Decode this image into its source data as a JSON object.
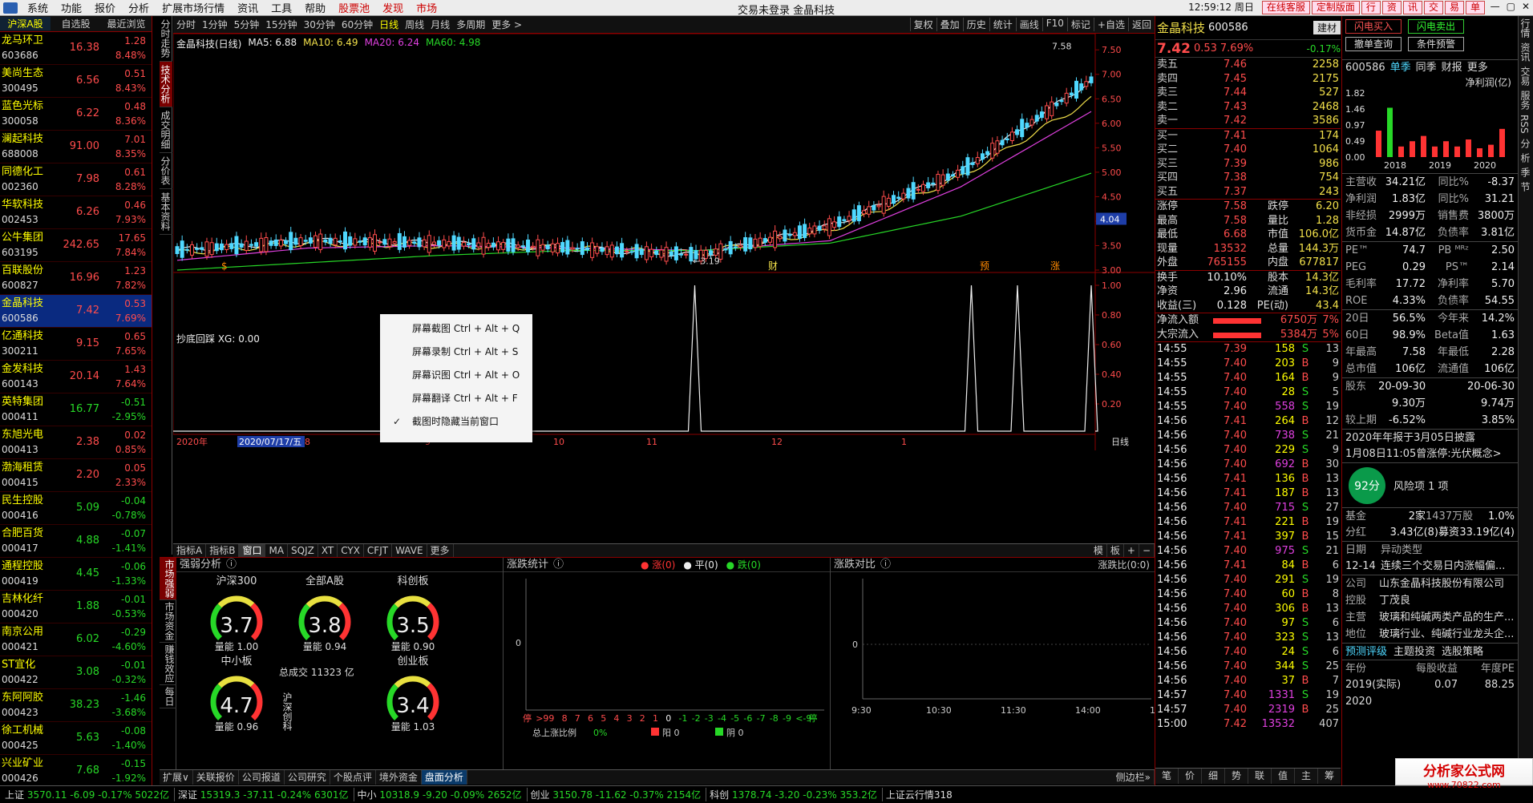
{
  "menubar": {
    "items": [
      {
        "label": "系统",
        "hot": false
      },
      {
        "label": "功能",
        "hot": false
      },
      {
        "label": "报价",
        "hot": false
      },
      {
        "label": "分析",
        "hot": false
      },
      {
        "label": "扩展市场行情",
        "hot": false
      },
      {
        "label": "资讯",
        "hot": false
      },
      {
        "label": "工具",
        "hot": false
      },
      {
        "label": "帮助",
        "hot": false
      },
      {
        "label": "股票池",
        "hot": true
      },
      {
        "label": "发现",
        "hot": true
      },
      {
        "label": "市场",
        "hot": true
      }
    ],
    "title": "交易未登录  金晶科技",
    "clock": "12:59:12 周日",
    "right_buttons": [
      "在线客服",
      "定制版面",
      "行",
      "资",
      "讯",
      "交",
      "易",
      "单"
    ],
    "window_controls": [
      "—",
      "▢",
      "✕"
    ]
  },
  "left": {
    "tabs": [
      "沪深A股",
      "自选股",
      "最近浏览"
    ],
    "stocks": [
      {
        "name": "龙马环卫",
        "code": "603686",
        "price": "16.38",
        "chg": "1.28",
        "pct": "8.48%",
        "dir": "up"
      },
      {
        "name": "美尚生态",
        "code": "300495",
        "price": "6.56",
        "chg": "0.51",
        "pct": "8.43%",
        "dir": "up"
      },
      {
        "name": "蓝色光标",
        "code": "300058",
        "price": "6.22",
        "chg": "0.48",
        "pct": "8.36%",
        "dir": "up"
      },
      {
        "name": "澜起科技",
        "code": "688008",
        "price": "91.00",
        "chg": "7.01",
        "pct": "8.35%",
        "dir": "up"
      },
      {
        "name": "同德化工",
        "code": "002360",
        "price": "7.98",
        "chg": "0.61",
        "pct": "8.28%",
        "dir": "up"
      },
      {
        "name": "华软科技",
        "code": "002453",
        "price": "6.26",
        "chg": "0.46",
        "pct": "7.93%",
        "dir": "up"
      },
      {
        "name": "公牛集团",
        "code": "603195",
        "price": "242.65",
        "chg": "17.65",
        "pct": "7.84%",
        "dir": "up"
      },
      {
        "name": "百联股份",
        "code": "600827",
        "price": "16.96",
        "chg": "1.23",
        "pct": "7.82%",
        "dir": "up"
      },
      {
        "name": "金晶科技",
        "code": "600586",
        "price": "7.42",
        "chg": "0.53",
        "pct": "7.69%",
        "dir": "up",
        "selected": true
      },
      {
        "name": "亿通科技",
        "code": "300211",
        "price": "9.15",
        "chg": "0.65",
        "pct": "7.65%",
        "dir": "up"
      },
      {
        "name": "金发科技",
        "code": "600143",
        "price": "20.14",
        "chg": "1.43",
        "pct": "7.64%",
        "dir": "up"
      },
      {
        "name": "英特集团",
        "code": "000411",
        "price": "16.77",
        "chg": "-0.51",
        "pct": "-2.95%",
        "dir": "dn"
      },
      {
        "name": "东旭光电",
        "code": "000413",
        "price": "2.38",
        "chg": "0.02",
        "pct": "0.85%",
        "dir": "up"
      },
      {
        "name": "渤海租赁",
        "code": "000415",
        "price": "2.20",
        "chg": "0.05",
        "pct": "2.33%",
        "dir": "up"
      },
      {
        "name": "民生控股",
        "code": "000416",
        "price": "5.09",
        "chg": "-0.04",
        "pct": "-0.78%",
        "dir": "dn"
      },
      {
        "name": "合肥百货",
        "code": "000417",
        "price": "4.88",
        "chg": "-0.07",
        "pct": "-1.41%",
        "dir": "dn"
      },
      {
        "name": "通程控股",
        "code": "000419",
        "price": "4.45",
        "chg": "-0.06",
        "pct": "-1.33%",
        "dir": "dn"
      },
      {
        "name": "吉林化纤",
        "code": "000420",
        "price": "1.88",
        "chg": "-0.01",
        "pct": "-0.53%",
        "dir": "dn"
      },
      {
        "name": "南京公用",
        "code": "000421",
        "price": "6.02",
        "chg": "-0.29",
        "pct": "-4.60%",
        "dir": "dn"
      },
      {
        "name": "ST宜化",
        "code": "000422",
        "price": "3.08",
        "chg": "-0.01",
        "pct": "-0.32%",
        "dir": "dn"
      },
      {
        "name": "东阿阿胶",
        "code": "000423",
        "price": "38.23",
        "chg": "-1.46",
        "pct": "-3.68%",
        "dir": "dn"
      },
      {
        "name": "徐工机械",
        "code": "000425",
        "price": "5.63",
        "chg": "-0.08",
        "pct": "-1.40%",
        "dir": "dn"
      },
      {
        "name": "兴业矿业",
        "code": "000426",
        "price": "7.68",
        "chg": "-0.15",
        "pct": "-1.92%",
        "dir": "dn"
      }
    ]
  },
  "side_tabs": [
    "分时走势",
    "技术分析",
    "成交明细",
    "分价表",
    "基本资料"
  ],
  "ktool": {
    "periods": [
      "分时",
      "1分钟",
      "5分钟",
      "15分钟",
      "30分钟",
      "60分钟",
      "日线",
      "周线",
      "月线",
      "多周期",
      "更多 >"
    ],
    "active": "日线",
    "right": [
      "复权",
      "叠加",
      "历史",
      "统计",
      "画线",
      "F10",
      "标记",
      "+自选",
      "返回"
    ]
  },
  "chart": {
    "title": "金晶科技(日线)",
    "ma_legend": [
      {
        "label": "MA5: 6.88",
        "color": "#eeeeee"
      },
      {
        "label": "MA10: 6.49",
        "color": "#f2e04a"
      },
      {
        "label": "MA20: 6.24",
        "color": "#e040e0"
      },
      {
        "label": "MA60: 4.98",
        "color": "#27d827"
      }
    ],
    "price_ticks": [
      "7.50",
      "7.00",
      "6.50",
      "6.00",
      "5.50",
      "5.00",
      "4.50",
      "4.00",
      "3.50",
      "3.00"
    ],
    "high_label": "7.58",
    "low_label": "3.19",
    "cursor_price": "4.04",
    "markers": [
      "$",
      "财",
      "预",
      "涨"
    ],
    "indicator_title": "抄底回踩  XG: 0.00",
    "indicator_ticks": [
      "1.00",
      "0.80",
      "0.60",
      "0.40",
      "0.20"
    ],
    "date_labels": [
      "2020年",
      "2020/07/17/五",
      "8",
      "9",
      "10",
      "11",
      "12",
      "1"
    ],
    "period_label": "日线"
  },
  "chart_data": {
    "type": "line",
    "title": "金晶科技(日线)",
    "xlabel": "",
    "ylabel": "",
    "ylim": [
      3.0,
      7.7
    ],
    "x": [
      "2020-06",
      "2020-07",
      "2020-08",
      "2020-09",
      "2020-10",
      "2020-11",
      "2020-12",
      "2021-01"
    ],
    "series": [
      {
        "name": "MA5",
        "values": [
          3.4,
          3.6,
          3.55,
          3.45,
          3.3,
          3.9,
          5.0,
          6.88
        ]
      },
      {
        "name": "MA10",
        "values": [
          3.35,
          3.55,
          3.5,
          3.45,
          3.35,
          3.8,
          4.9,
          6.49
        ]
      },
      {
        "name": "MA20",
        "values": [
          3.2,
          3.45,
          3.5,
          3.45,
          3.4,
          3.6,
          4.7,
          6.24
        ]
      },
      {
        "name": "MA60",
        "values": [
          3.0,
          3.15,
          3.3,
          3.4,
          3.4,
          3.55,
          4.1,
          4.98
        ]
      }
    ],
    "indicator": {
      "name": "XG",
      "signal_positions": [
        0.47,
        0.77,
        0.82,
        0.9
      ],
      "value": 0.0
    }
  },
  "context_menu": [
    {
      "label": "屏幕截图 Ctrl + Alt + Q",
      "checked": false
    },
    {
      "label": "屏幕录制 Ctrl + Alt + S",
      "checked": false
    },
    {
      "label": "屏幕识图 Ctrl + Alt + O",
      "checked": false
    },
    {
      "label": "屏幕翻译 Ctrl + Alt + F",
      "checked": false
    },
    {
      "label": "截图时隐藏当前窗口",
      "checked": true
    }
  ],
  "index_tabs": [
    "指标A",
    "指标B",
    "窗口",
    "MA",
    "SQJZ",
    "XT",
    "CYX",
    "CFJT",
    "WAVE",
    "更多"
  ],
  "index_tabs_right": [
    "模",
    "板",
    "+",
    "−"
  ],
  "bottom": {
    "vtabs": [
      "市场强弱",
      "市场资金",
      "赚钱效应",
      "每日"
    ],
    "strength": {
      "title": "强弱分析",
      "gauges": [
        {
          "name": "沪深300",
          "value": "3.7",
          "q": "量能 1.00"
        },
        {
          "name": "全部A股",
          "value": "3.8",
          "q": "量能 0.94"
        },
        {
          "name": "科创板",
          "value": "3.5",
          "q": "量能 0.90"
        },
        {
          "name": "中小板",
          "value": "4.7",
          "q": "量能 0.96"
        },
        {
          "name": "创业板",
          "value": "3.4",
          "q": "量能 1.03"
        }
      ],
      "total": "总成交 11323 亿",
      "vertical_label": "沪深创科"
    },
    "rise_fall": {
      "title": "涨跌统计",
      "legend": [
        "涨(0)",
        "平(0)",
        "跌(0)"
      ],
      "zero": "0",
      "xaxis": [
        "停",
        ">9",
        "9",
        "8",
        "7",
        "6",
        "5",
        "4",
        "3",
        "2",
        "1",
        "0",
        "-1",
        "-2",
        "-3",
        "-4",
        "-5",
        "-6",
        "-7",
        "-8",
        "-9",
        "<-9",
        "停"
      ],
      "footer": {
        "ratio_label": "总上涨比例",
        "ratio": "0%",
        "yang": "阳 0",
        "yin": "阴 0"
      }
    },
    "compare": {
      "title": "涨跌对比",
      "ratio": "涨跌比(0:0)",
      "zero": "0",
      "times": [
        "9:30",
        "10:30",
        "11:30",
        "14:00",
        "15:00"
      ]
    }
  },
  "btabs": [
    "扩展∨",
    "关联报价",
    "公司报道",
    "公司研究",
    "个股点评",
    "境外资金",
    "盘面分析"
  ],
  "btabs_active": "盘面分析",
  "btabs_right": "侧边栏»",
  "status": [
    {
      "label": "上证",
      "vals": "3570.11  -6.09  -0.17%  5022亿"
    },
    {
      "label": "深证",
      "vals": "15319.3  -37.11  -0.24%  6301亿"
    },
    {
      "label": "中小",
      "vals": "10318.9  -9.20  -0.09%  2652亿"
    },
    {
      "label": "创业",
      "vals": "3150.78  -11.62  -0.37%  2154亿"
    },
    {
      "label": "科创",
      "vals": "1378.74  -3.20  -0.23%  353.2亿"
    },
    {
      "label": "",
      "vals": "上证云行情318"
    }
  ],
  "quote": {
    "name": "金晶科技",
    "code": "600586",
    "sector": "建材",
    "sector_pct": "-0.17%",
    "price": "7.42",
    "chg": "0.53",
    "pct": "7.69%",
    "asks": [
      {
        "l": "卖五",
        "p": "7.46",
        "v": "2258"
      },
      {
        "l": "卖四",
        "p": "7.45",
        "v": "2175"
      },
      {
        "l": "卖三",
        "p": "7.44",
        "v": "527"
      },
      {
        "l": "卖二",
        "p": "7.43",
        "v": "2468"
      },
      {
        "l": "卖一",
        "p": "7.42",
        "v": "3586"
      }
    ],
    "bids": [
      {
        "l": "买一",
        "p": "7.41",
        "v": "174"
      },
      {
        "l": "买二",
        "p": "7.40",
        "v": "1064"
      },
      {
        "l": "买三",
        "p": "7.39",
        "v": "986"
      },
      {
        "l": "买四",
        "p": "7.38",
        "v": "754"
      },
      {
        "l": "买五",
        "p": "7.37",
        "v": "243"
      }
    ],
    "stats": [
      [
        "涨停",
        "7.58",
        "跌停",
        "6.20"
      ],
      [
        "最高",
        "7.58",
        "量比",
        "1.28"
      ],
      [
        "最低",
        "6.68",
        "市值",
        "106.0亿"
      ],
      [
        "现量",
        "13532",
        "总量",
        "144.3万"
      ],
      [
        "外盘",
        "765155",
        "内盘",
        "677817"
      ]
    ],
    "stats2": [
      [
        "换手",
        "10.10%",
        "股本",
        "14.3亿"
      ],
      [
        "净资",
        "2.96",
        "流通",
        "14.3亿"
      ],
      [
        "收益(三)",
        "0.128",
        "PE(动)",
        "43.4"
      ]
    ],
    "flows": [
      {
        "l": "净流入额",
        "v": "6750万",
        "p": "7%"
      },
      {
        "l": "大宗流入",
        "v": "5384万",
        "p": "5%"
      }
    ],
    "ticks": [
      {
        "t": "14:55",
        "p": "7.39",
        "v": "158",
        "d": "S",
        "n": "13"
      },
      {
        "t": "14:55",
        "p": "7.40",
        "v": "203",
        "d": "B",
        "n": "9"
      },
      {
        "t": "14:55",
        "p": "7.40",
        "v": "164",
        "d": "B",
        "n": "9"
      },
      {
        "t": "14:55",
        "p": "7.40",
        "v": "28",
        "d": "S",
        "n": "5"
      },
      {
        "t": "14:55",
        "p": "7.40",
        "v": "558",
        "d": "S",
        "n": "19"
      },
      {
        "t": "14:56",
        "p": "7.41",
        "v": "264",
        "d": "B",
        "n": "12"
      },
      {
        "t": "14:56",
        "p": "7.40",
        "v": "738",
        "d": "S",
        "n": "21"
      },
      {
        "t": "14:56",
        "p": "7.40",
        "v": "229",
        "d": "S",
        "n": "9"
      },
      {
        "t": "14:56",
        "p": "7.40",
        "v": "692",
        "d": "B",
        "n": "30"
      },
      {
        "t": "14:56",
        "p": "7.41",
        "v": "136",
        "d": "B",
        "n": "13"
      },
      {
        "t": "14:56",
        "p": "7.41",
        "v": "187",
        "d": "B",
        "n": "13"
      },
      {
        "t": "14:56",
        "p": "7.40",
        "v": "715",
        "d": "S",
        "n": "27"
      },
      {
        "t": "14:56",
        "p": "7.41",
        "v": "221",
        "d": "B",
        "n": "19"
      },
      {
        "t": "14:56",
        "p": "7.41",
        "v": "397",
        "d": "B",
        "n": "15"
      },
      {
        "t": "14:56",
        "p": "7.40",
        "v": "975",
        "d": "S",
        "n": "21"
      },
      {
        "t": "14:56",
        "p": "7.41",
        "v": "84",
        "d": "B",
        "n": "6"
      },
      {
        "t": "14:56",
        "p": "7.40",
        "v": "291",
        "d": "S",
        "n": "19"
      },
      {
        "t": "14:56",
        "p": "7.40",
        "v": "60",
        "d": "B",
        "n": "8"
      },
      {
        "t": "14:56",
        "p": "7.40",
        "v": "306",
        "d": "B",
        "n": "13"
      },
      {
        "t": "14:56",
        "p": "7.40",
        "v": "97",
        "d": "S",
        "n": "6"
      },
      {
        "t": "14:56",
        "p": "7.40",
        "v": "323",
        "d": "S",
        "n": "13"
      },
      {
        "t": "14:56",
        "p": "7.40",
        "v": "24",
        "d": "S",
        "n": "6"
      },
      {
        "t": "14:56",
        "p": "7.40",
        "v": "344",
        "d": "S",
        "n": "25"
      },
      {
        "t": "14:56",
        "p": "7.40",
        "v": "37",
        "d": "B",
        "n": "7"
      },
      {
        "t": "14:57",
        "p": "7.40",
        "v": "1331",
        "d": "S",
        "n": "19"
      },
      {
        "t": "14:57",
        "p": "7.40",
        "v": "2319",
        "d": "B",
        "n": "25"
      },
      {
        "t": "15:00",
        "p": "7.42",
        "v": "13532",
        "d": "",
        "n": "407"
      }
    ],
    "bottom_tabs": [
      "笔",
      "价",
      "细",
      "势",
      "联",
      "值",
      "主",
      "筹"
    ]
  },
  "f10": {
    "buttons": [
      "闪电买入",
      "闪电卖出",
      "撤单查询",
      "条件预警"
    ],
    "code": "600586",
    "tabs": [
      "单季",
      "同季",
      "财报",
      "更多"
    ],
    "chart_title": "净利润(亿)",
    "chart_ticks": [
      "1.82",
      "1.46",
      "0.97",
      "0.49",
      "0.00"
    ],
    "years": [
      "2018",
      "2019",
      "2020"
    ],
    "bars": [
      {
        "v": 0.75,
        "c": "#ff3333"
      },
      {
        "v": 1.4,
        "c": "#27d827"
      },
      {
        "v": 0.3,
        "c": "#ff3333"
      },
      {
        "v": 0.45,
        "c": "#ff3333"
      },
      {
        "v": 0.6,
        "c": "#ff3333"
      },
      {
        "v": 0.3,
        "c": "#ff3333"
      },
      {
        "v": 0.45,
        "c": "#ff3333"
      },
      {
        "v": 0.3,
        "c": "#ff3333"
      },
      {
        "v": 0.5,
        "c": "#ff3333"
      },
      {
        "v": 0.25,
        "c": "#ff3333"
      },
      {
        "v": 0.35,
        "c": "#ff3333"
      },
      {
        "v": 0.8,
        "c": "#ff3333"
      }
    ],
    "fin": [
      [
        "主营收",
        "34.21亿",
        "同比%",
        "-8.37"
      ],
      [
        "净利润",
        "1.83亿",
        "同比%",
        "31.21"
      ],
      [
        "非经损",
        "2999万",
        "销售费",
        "3800万"
      ],
      [
        "货币金",
        "14.87亿",
        "负债率",
        "3.81亿"
      ]
    ],
    "val": [
      [
        "PE™",
        "74.7",
        "PB ᴹᴿᶻ",
        "2.50"
      ],
      [
        "PEG",
        "0.29",
        "PS™",
        "2.14"
      ],
      [
        "毛利率",
        "17.72",
        "净利率",
        "5.70"
      ],
      [
        "ROE",
        "4.33%",
        "负债率",
        "54.55"
      ]
    ],
    "perf": [
      [
        "20日",
        "56.5%",
        "今年来",
        "14.2%"
      ],
      [
        "60日",
        "98.9%",
        "Beta值",
        "1.63"
      ],
      [
        "年最高",
        "7.58",
        "年最低",
        "2.28"
      ],
      [
        "总市值",
        "106亿",
        "流通值",
        "106亿"
      ]
    ],
    "holders": [
      [
        "股东",
        "20-09-30",
        "",
        "20-06-30"
      ],
      [
        "",
        "9.30万",
        "",
        "9.74万"
      ],
      [
        "较上期",
        "-6.52%",
        "",
        "3.85%"
      ]
    ],
    "notice1": "2020年年报于3月05日披露",
    "notice2": "1月08日11:05曾涨停:光伏概念>",
    "score": "92分",
    "risk": "风险项 1 项",
    "fund": [
      "基金",
      "2家",
      "1437万股",
      "1.0%"
    ],
    "split": [
      "分红",
      "3.43亿(8)募资",
      "33.19亿(4)"
    ],
    "anomaly_head": [
      "日期",
      "异动类型"
    ],
    "anomaly": [
      "12-14",
      "连续三个交易日内涨幅偏..."
    ],
    "company": [
      [
        "公司",
        "山东金晶科技股份有限公司"
      ],
      [
        "控股",
        "丁茂良"
      ],
      [
        "主营",
        "玻璃和纯碱两类产品的生产..."
      ],
      [
        "地位",
        "玻璃行业、纯碱行业龙头企..."
      ]
    ],
    "links": [
      "预测评级",
      "主题投资",
      "选股策略"
    ],
    "eps_head": [
      "年份",
      "每股收益",
      "年度PE"
    ],
    "eps": [
      [
        "2019(实际)",
        "0.07",
        "88.25"
      ],
      [
        "2020",
        "",
        ""
      ]
    ]
  },
  "vstrip": [
    "行情",
    "资讯",
    "交易",
    "服务",
    "RSS",
    "分",
    "析",
    "季",
    "节"
  ],
  "watermark": {
    "line1": "分析家公式网",
    "line2": "www.70822.com"
  }
}
